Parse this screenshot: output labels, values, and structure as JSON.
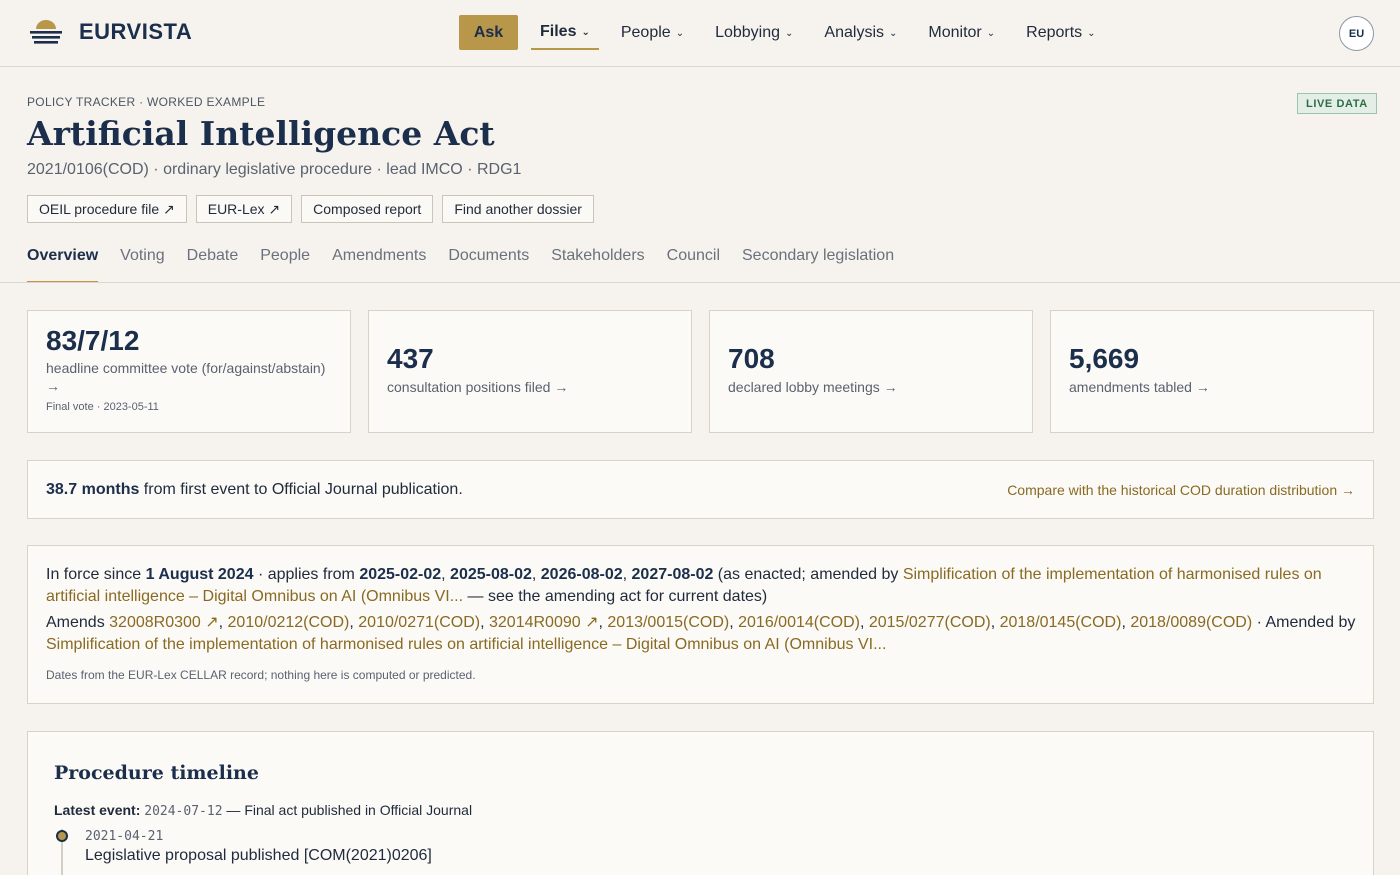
{
  "brand": {
    "name": "EURVISTA"
  },
  "nav": {
    "ask_label": "Ask",
    "items": [
      {
        "label": "Files",
        "active": true
      },
      {
        "label": "People"
      },
      {
        "label": "Lobbying"
      },
      {
        "label": "Analysis"
      },
      {
        "label": "Monitor"
      },
      {
        "label": "Reports"
      }
    ],
    "avatar_label": "EU"
  },
  "header": {
    "eyebrow": "POLICY TRACKER · WORKED EXAMPLE",
    "badge": "LIVE DATA",
    "title": "Artificial Intelligence Act",
    "subtitle": "2021/0106(COD) · ordinary legislative procedure · lead IMCO · RDG1",
    "buttons": [
      "OEIL procedure file ↗",
      "EUR-Lex ↗",
      "Composed report",
      "Find another dossier"
    ]
  },
  "tabs": [
    "Overview",
    "Voting",
    "Debate",
    "People",
    "Amendments",
    "Documents",
    "Stakeholders",
    "Council",
    "Secondary legislation"
  ],
  "stats": [
    {
      "value": "83/7/12",
      "label": "headline committee vote (for/against/abstain) →",
      "foot": "Final vote · 2023-05-11"
    },
    {
      "value": "437",
      "label": "consultation positions filed →"
    },
    {
      "value": "708",
      "label": "declared lobby meetings →"
    },
    {
      "value": "5,669",
      "label": "amendments tabled →"
    }
  ],
  "duration": {
    "value": "38.7 months",
    "text": " from first event to Official Journal publication.",
    "link": "Compare with the historical COD duration distribution →"
  },
  "in_force": {
    "prefix": "In force since ",
    "since": "1 August 2024",
    "applies_text": " · applies from ",
    "dates": [
      "2025-02-02",
      "2025-08-02",
      "2026-08-02",
      "2027-08-02"
    ],
    "sep": ", ",
    "amended_text": " (as enacted; amended by ",
    "amending_act": "Simplification of the implementation of harmonised rules on artificial intelligence – Digital Omnibus on AI (Omnibus VI...",
    "amended_suffix": " — see the amending act for current dates)",
    "amends_label": "Amends ",
    "amends": [
      "32008R0300 ↗",
      "2010/0212(COD)",
      "2010/0271(COD)",
      "32014R0090 ↗",
      "2013/0015(COD)",
      "2016/0014(COD)",
      "2015/0277(COD)",
      "2018/0145(COD)",
      "2018/0089(COD)"
    ],
    "amended_by_label": " · Amended by",
    "amended_by": "Simplification of the implementation of harmonised rules on artificial intelligence – Digital Omnibus on AI (Omnibus VI...",
    "note": "Dates from the EUR-Lex CELLAR record; nothing here is computed or predicted."
  },
  "timeline": {
    "title": "Procedure timeline",
    "latest_label": "Latest event:",
    "latest_date": "2024-07-12",
    "latest_dash": " — ",
    "latest_text": "Final act published in Official Journal",
    "events": [
      {
        "date": "2021-04-21",
        "text": "Legislative proposal published [COM(2021)0206]"
      }
    ]
  },
  "colors": {
    "accent": "#b8964a",
    "navy": "#1b2e4b",
    "link": "#8a6a22",
    "background": "#f6f3ee"
  }
}
